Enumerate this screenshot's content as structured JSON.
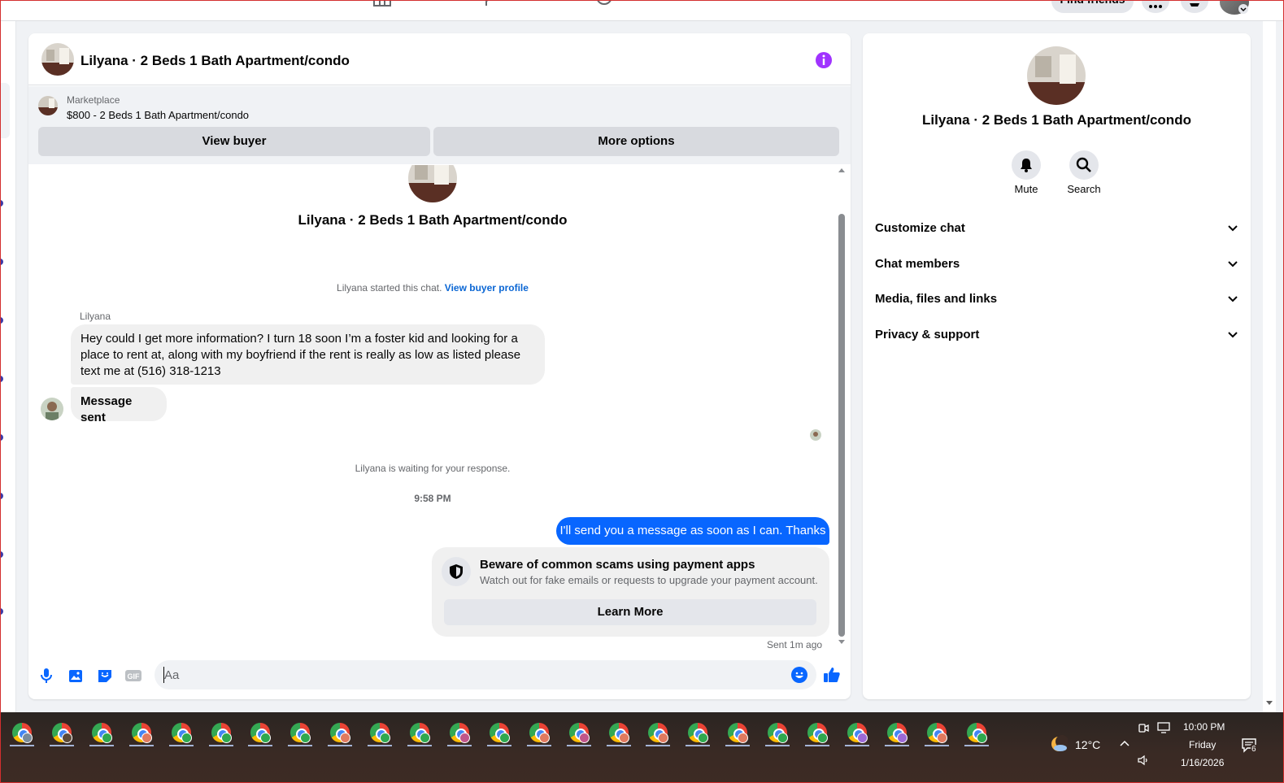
{
  "topnav": {
    "find_friends": "Find friends"
  },
  "chat": {
    "title": "Lilyana · 2 Beds 1 Bath Apartment/condo",
    "listing": {
      "category": "Marketplace",
      "title": "$800 - 2 Beds 1 Bath Apartment/condo"
    },
    "view_buyer": "View buyer",
    "more_options": "More options",
    "conv_title": "Lilyana · 2 Beds 1 Bath Apartment/condo",
    "started_text": "Lilyana started this chat.",
    "view_buyer_profile": "View buyer profile",
    "sender_name": "Lilyana",
    "message_1": "Hey could I get more information? I turn 18 soon I’m a foster kid and looking for a place to rent at, along with my boyfriend if the rent is really as low as listed please text me at (516) 318-1213",
    "message_2": "Message sent",
    "waiting_text": "Lilyana is waiting for your response.",
    "timestamp": "9:58 PM",
    "outgoing_message": "I'll send you a message as soon as I can. Thanks",
    "scam_title": "Beware of common scams using payment apps",
    "scam_subtitle": "Watch out for fake emails or requests to upgrade your payment account.",
    "learn_more": "Learn More",
    "sent_ago": "Sent 1m ago",
    "composer_placeholder": "Aa",
    "composer_value": ""
  },
  "info_panel": {
    "title": "Lilyana · 2 Beds 1 Bath Apartment/condo",
    "actions": {
      "mute": "Mute",
      "search": "Search"
    },
    "sections": [
      "Customize chat",
      "Chat members",
      "Media, files and links",
      "Privacy & support"
    ]
  },
  "taskbar": {
    "temperature": "12°C",
    "time": "10:00 PM",
    "day": "Friday",
    "date": "1/16/2026",
    "notification_count": "6",
    "app_count": 25
  },
  "colors": {
    "accent": "#0866ff",
    "info_icon": "#a033ff",
    "link": "#0a66d4"
  }
}
